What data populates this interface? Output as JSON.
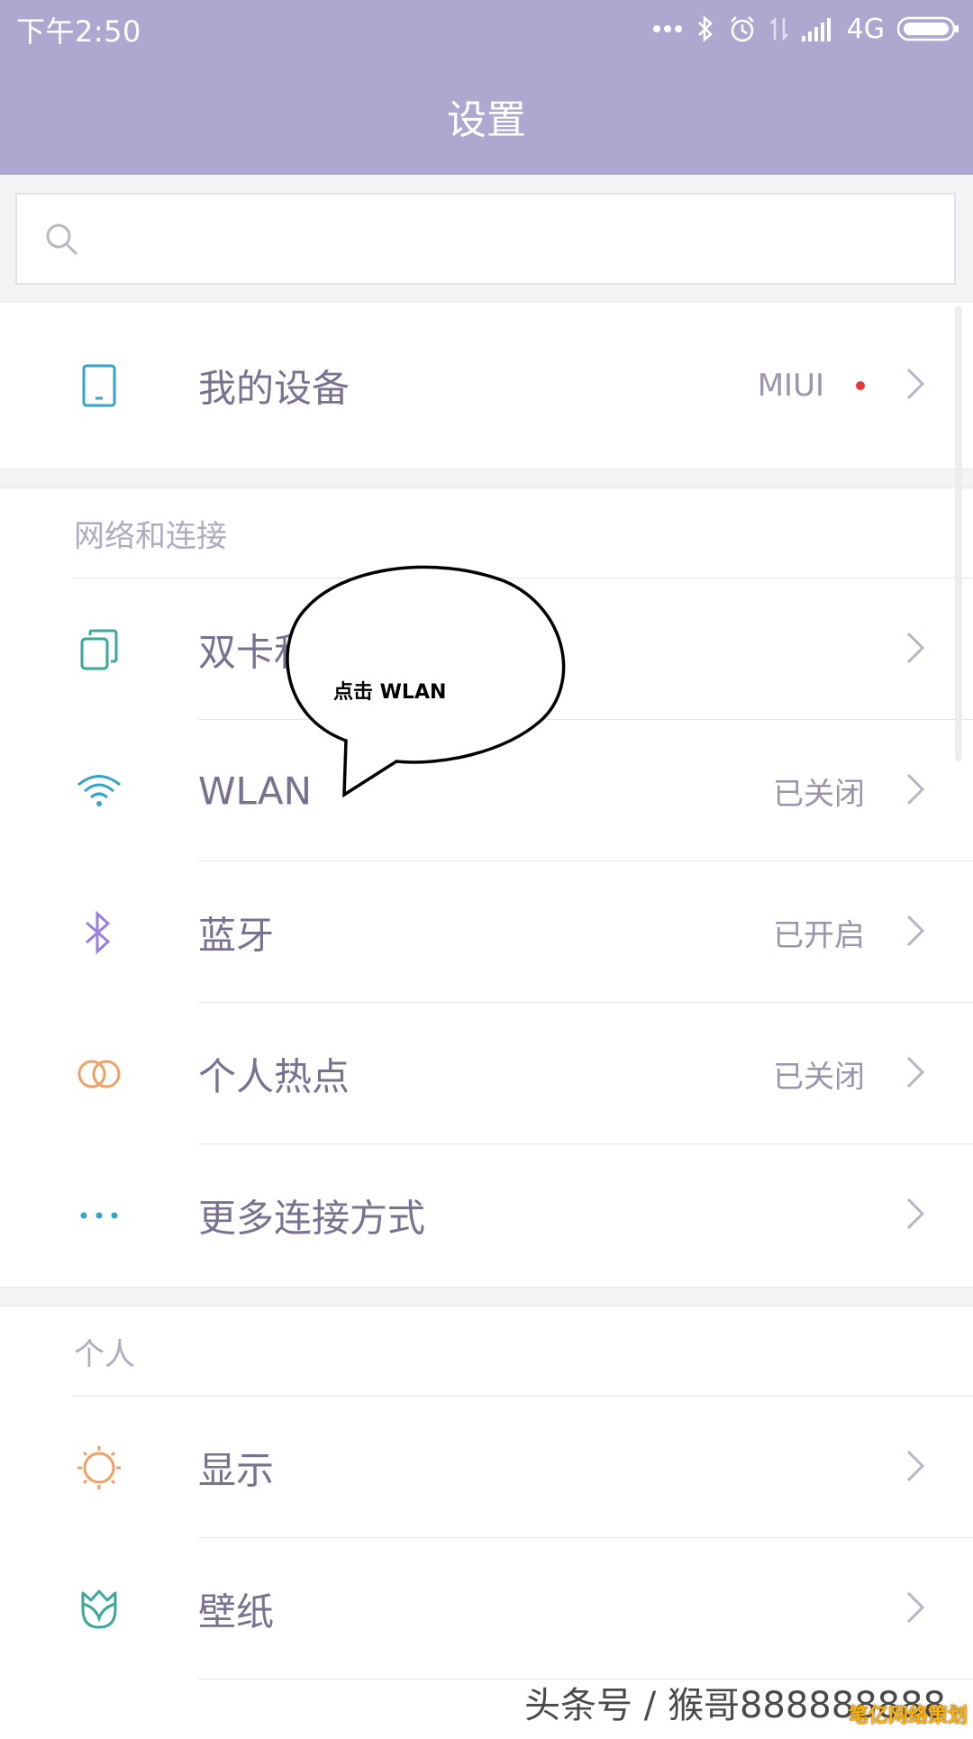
{
  "status_bar": {
    "time": "下午2:50",
    "network": "4G"
  },
  "header": {
    "title": "设置"
  },
  "search": {
    "placeholder": ""
  },
  "my_device": {
    "label": "我的设备",
    "value": "MIUI"
  },
  "network_section": {
    "header": "网络和连接",
    "items": [
      {
        "label": "双卡和移动网络",
        "value": "",
        "icon": "sim-cards-icon",
        "color": "#3aa89a"
      },
      {
        "label": "WLAN",
        "value": "已关闭",
        "icon": "wifi-icon",
        "color": "#33a3c9"
      },
      {
        "label": "蓝牙",
        "value": "已开启",
        "icon": "bluetooth-icon",
        "color": "#9a7fe0"
      },
      {
        "label": "个人热点",
        "value": "已关闭",
        "icon": "hotspot-icon",
        "color": "#f0a064"
      },
      {
        "label": "更多连接方式",
        "value": "",
        "icon": "more-dots-icon",
        "color": "#33a3c9"
      }
    ]
  },
  "personal_section": {
    "header": "个人",
    "items": [
      {
        "label": "显示",
        "icon": "display-sun-icon",
        "color": "#f0a064"
      },
      {
        "label": "壁纸",
        "icon": "wallpaper-tulip-icon",
        "color": "#3aa89a"
      }
    ]
  },
  "callout": {
    "text": "点击 WLAN"
  },
  "watermark": {
    "text": "头条号 / 猴哥888888888",
    "badge": "笔亿网络策划"
  }
}
